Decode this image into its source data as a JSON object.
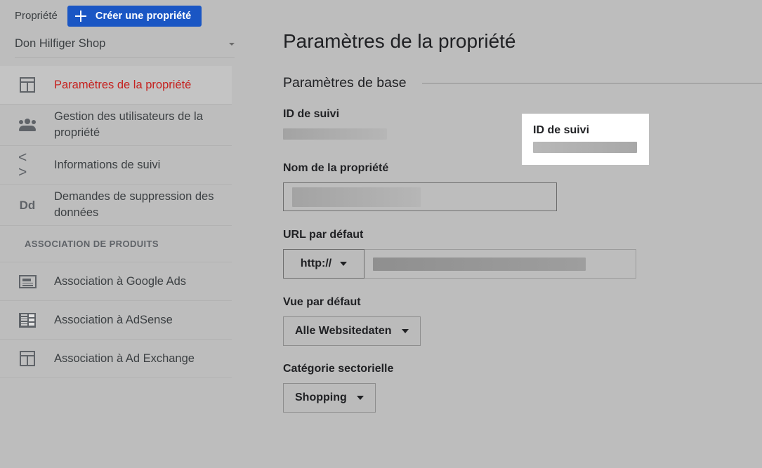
{
  "sidebar": {
    "property_label": "Propriété",
    "create_button": "Créer une propriété",
    "create_button_color": "#1a56c4",
    "account_name": "Don Hilfiger Shop",
    "items": [
      {
        "label": "Paramètres de la propriété",
        "icon": "layout-icon",
        "active": true
      },
      {
        "label": "Gestion des utilisateurs de la propriété",
        "icon": "people-icon",
        "active": false
      },
      {
        "label": "Informations de suivi",
        "icon": "code-icon",
        "active": false
      },
      {
        "label": "Demandes de suppression des données",
        "icon": "dd-icon",
        "active": false
      }
    ],
    "section_title": "ASSOCIATION DE PRODUITS",
    "product_items": [
      {
        "label": "Association à Google Ads",
        "icon": "card-icon"
      },
      {
        "label": "Association à AdSense",
        "icon": "grid-icon"
      },
      {
        "label": "Association à Ad Exchange",
        "icon": "layout-icon"
      }
    ],
    "active_label_color": "#c5221f"
  },
  "main": {
    "page_title": "Paramètres de la propriété",
    "section_heading": "Paramètres de base",
    "tracking_id": {
      "label": "ID de suivi",
      "value": "",
      "redacted": true
    },
    "property_name": {
      "label": "Nom de la propriété",
      "value": "",
      "redacted": true
    },
    "default_url": {
      "label": "URL par défaut",
      "protocol": "http://",
      "value": "",
      "redacted": true
    },
    "default_view": {
      "label": "Vue par défaut",
      "value": "Alle Websitedaten"
    },
    "industry_category": {
      "label": "Catégorie sectorielle",
      "value": "Shopping"
    }
  }
}
